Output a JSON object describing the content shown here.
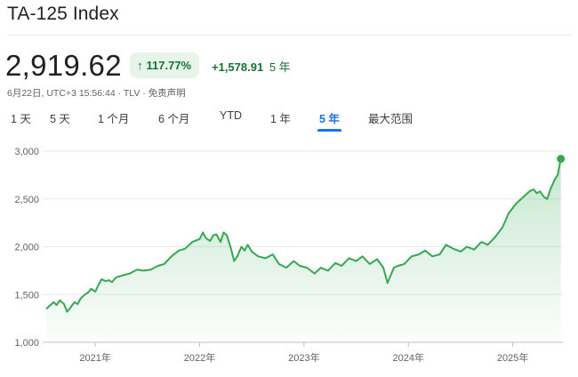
{
  "header": {
    "title": "TA-125 Index"
  },
  "quote": {
    "price": "2,919.62",
    "percent_change": "117.77%",
    "percent_direction_icon": "arrow-up-icon",
    "absolute_change": "+1,578.91",
    "period": "5 年",
    "timestamp": "6月22日, UTC+3 15:56:44",
    "exchange": "TLV",
    "disclaimer": "免责声明",
    "meta_separator": "·"
  },
  "tabs": [
    {
      "label": "1 天",
      "active": false
    },
    {
      "label": "5 天",
      "active": false
    },
    {
      "label": "1 个月",
      "active": false
    },
    {
      "label": "6 个月",
      "active": false
    },
    {
      "label": "YTD",
      "active": false
    },
    {
      "label": "1 年",
      "active": false
    },
    {
      "label": "5 年",
      "active": true
    },
    {
      "label": "最大范围",
      "active": false
    }
  ],
  "colors": {
    "line": "#34a853",
    "positive_text": "#137333",
    "positive_bg": "#e6f4ea",
    "tab_active": "#1a73e8"
  },
  "chart_data": {
    "type": "area",
    "x_tick_labels": [
      "2021年",
      "2022年",
      "2023年",
      "2024年",
      "2025年"
    ],
    "y_tick_labels": [
      "3,000",
      "2,500",
      "2,000",
      "1,500",
      "1,000"
    ],
    "y_ticks": [
      3000,
      2500,
      2000,
      1500,
      1000
    ],
    "x_ticks": [
      2021.0,
      2022.0,
      2023.0,
      2024.0,
      2025.0
    ],
    "xlim": [
      2020.53,
      2025.48
    ],
    "ylim": [
      1000,
      3000
    ],
    "grid": true,
    "series": [
      {
        "x": [
          2020.53,
          2020.56,
          2020.6,
          2020.63,
          2020.66,
          2020.7,
          2020.73,
          2020.76,
          2020.8,
          2020.83,
          2020.86,
          2020.9,
          2020.93,
          2020.96,
          2021.0,
          2021.03,
          2021.06,
          2021.1,
          2021.13,
          2021.16,
          2021.2,
          2021.26,
          2021.33,
          2021.4,
          2021.46,
          2021.53,
          2021.6,
          2021.66,
          2021.73,
          2021.8,
          2021.86,
          2021.93,
          2022.0,
          2022.03,
          2022.06,
          2022.1,
          2022.13,
          2022.16,
          2022.2,
          2022.23,
          2022.26,
          2022.3,
          2022.33,
          2022.36,
          2022.4,
          2022.43,
          2022.46,
          2022.5,
          2022.56,
          2022.63,
          2022.7,
          2022.76,
          2022.83,
          2022.9,
          2022.96,
          2023.03,
          2023.1,
          2023.16,
          2023.23,
          2023.3,
          2023.36,
          2023.43,
          2023.5,
          2023.56,
          2023.63,
          2023.7,
          2023.76,
          2023.8,
          2023.83,
          2023.86,
          2023.9,
          2023.96,
          2024.03,
          2024.1,
          2024.16,
          2024.23,
          2024.3,
          2024.36,
          2024.43,
          2024.5,
          2024.56,
          2024.63,
          2024.7,
          2024.76,
          2024.83,
          2024.9,
          2024.96,
          2025.03,
          2025.1,
          2025.16,
          2025.2,
          2025.23,
          2025.26,
          2025.3,
          2025.33,
          2025.36,
          2025.4,
          2025.43,
          2025.46
        ],
        "y": [
          1350,
          1380,
          1420,
          1390,
          1440,
          1400,
          1320,
          1360,
          1420,
          1400,
          1460,
          1500,
          1520,
          1560,
          1530,
          1600,
          1660,
          1640,
          1650,
          1630,
          1680,
          1700,
          1720,
          1760,
          1750,
          1760,
          1800,
          1820,
          1900,
          1960,
          1980,
          2050,
          2080,
          2150,
          2090,
          2060,
          2120,
          2130,
          2050,
          2150,
          2120,
          1980,
          1850,
          1900,
          2000,
          1960,
          2020,
          1950,
          1900,
          1880,
          1920,
          1820,
          1780,
          1850,
          1800,
          1780,
          1720,
          1780,
          1750,
          1830,
          1800,
          1880,
          1850,
          1900,
          1820,
          1870,
          1780,
          1620,
          1700,
          1780,
          1800,
          1820,
          1900,
          1920,
          1960,
          1900,
          1920,
          2020,
          1980,
          1950,
          2000,
          1970,
          2050,
          2020,
          2100,
          2200,
          2350,
          2450,
          2520,
          2580,
          2600,
          2560,
          2580,
          2520,
          2500,
          2600,
          2700,
          2750,
          2920
        ]
      }
    ],
    "last_point": {
      "y": 2919.62
    }
  }
}
